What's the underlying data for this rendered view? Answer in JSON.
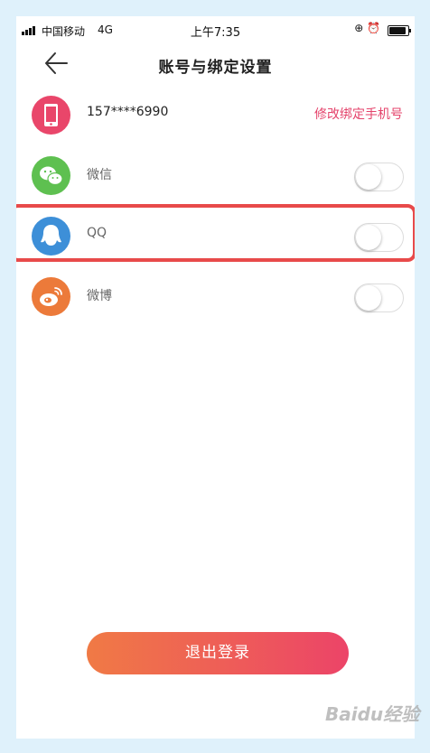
{
  "status_bar": {
    "carrier": "中国移动",
    "network": "4G",
    "time": "上午7:35",
    "icons": "⊕ ⏰"
  },
  "header": {
    "title": "账号与绑定设置"
  },
  "rows": [
    {
      "label": "157****6990",
      "link": "修改绑定手机号"
    },
    {
      "label": "微信",
      "toggle_on": false
    },
    {
      "label": "QQ",
      "toggle_on": false,
      "highlighted": true
    },
    {
      "label": "微博",
      "toggle_on": false
    }
  ],
  "logout_label": "退出登录",
  "watermark": "Baidu经验",
  "colors": {
    "accent": "#e4436b",
    "phone_icon": "#e9466a",
    "wechat_icon": "#5ec050",
    "qq_icon": "#3d8fd8",
    "weibo_icon": "#ec7a3a",
    "highlight_border": "#e84a4a",
    "page_bg": "#dff1fb"
  }
}
